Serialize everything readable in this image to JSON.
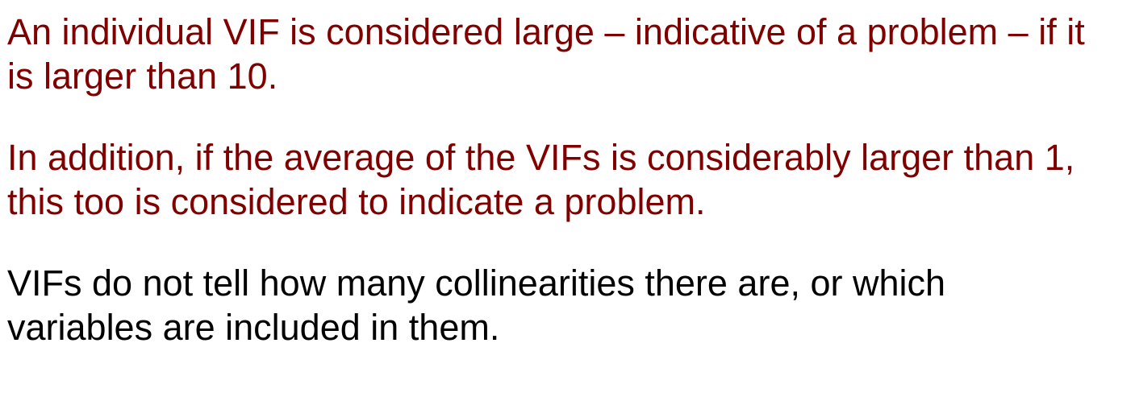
{
  "colors": {
    "emphasis": "#800000",
    "body": "#000000",
    "background": "#ffffff"
  },
  "paragraphs": [
    {
      "lines": [
        "An individual VIF is considered large – indicative of a problem – if it",
        "is larger than 10."
      ]
    },
    {
      "lines": [
        "In addition, if the average of the VIFs is considerably larger than 1,",
        "this too is considered to indicate a problem."
      ]
    },
    {
      "lines": [
        "VIFs do not tell how many collinearities there are, or which",
        "variables are included in them."
      ]
    }
  ]
}
